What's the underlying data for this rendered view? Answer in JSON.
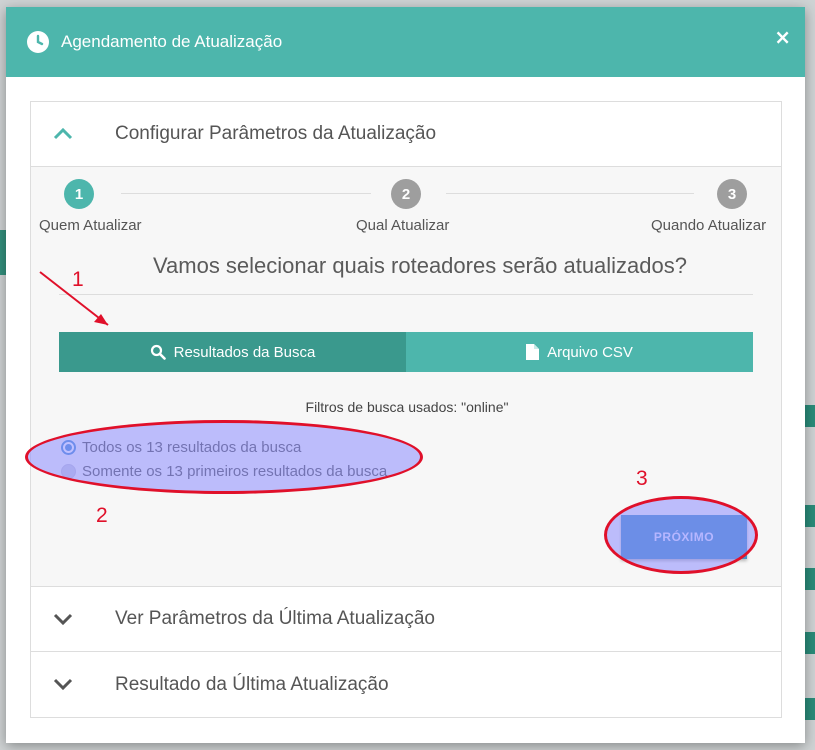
{
  "modal": {
    "title": "Agendamento de Atualização",
    "close_symbol": "×"
  },
  "sections": {
    "configure": "Configurar Parâmetros da Atualização",
    "last_params": "Ver Parâmetros da Última Atualização",
    "last_result": "Resultado da Última Atualização"
  },
  "stepper": {
    "steps": [
      {
        "number": "1",
        "label": "Quem Atualizar",
        "state": "active"
      },
      {
        "number": "2",
        "label": "Qual Atualizar",
        "state": "inactive"
      },
      {
        "number": "3",
        "label": "Quando Atualizar",
        "state": "inactive"
      }
    ]
  },
  "content": {
    "question": "Vamos selecionar quais roteadores serão atualizados?",
    "tabs": {
      "search_results": "Resultados da Busca",
      "csv_file": "Arquivo CSV"
    },
    "filters_text": "Filtros de busca usados: \"online\"",
    "options": {
      "all": "Todos os 13 resultados da busca",
      "first": "Somente os 13 primeiros resultados da busca"
    },
    "next_button": "PRÓXIMO"
  },
  "annotations": {
    "one": "1",
    "two": "2",
    "three": "3"
  },
  "colors": {
    "header": "#4db6ac",
    "tab_active": "#3a998d",
    "tab_inactive": "#4db6ac",
    "button": "#4591c9",
    "annotation": "#e0102a"
  }
}
